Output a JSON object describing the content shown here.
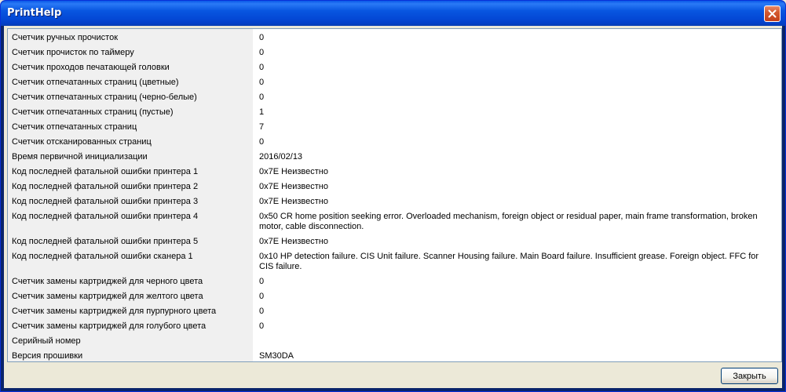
{
  "window": {
    "title": "PrintHelp",
    "close_icon": "close-icon"
  },
  "rows": [
    {
      "name": "Счетчик ручных прочисток",
      "value": "0"
    },
    {
      "name": "Счетчик прочисток по таймеру",
      "value": "0"
    },
    {
      "name": "Счетчик проходов печатающей головки",
      "value": "0"
    },
    {
      "name": "Счетчик отпечатанных страниц (цветные)",
      "value": "0"
    },
    {
      "name": "Счетчик отпечатанных страниц (черно-белые)",
      "value": "0"
    },
    {
      "name": "Счетчик отпечатанных страниц (пустые)",
      "value": "1"
    },
    {
      "name": "Счетчик отпечатанных страниц",
      "value": "7"
    },
    {
      "name": "Счетчик отсканированных страниц",
      "value": "0"
    },
    {
      "name": "Время первичной инициализации",
      "value": "2016/02/13"
    },
    {
      "name": "Код последней фатальной ошибки принтера 1",
      "value": "0x7E Неизвестно"
    },
    {
      "name": "Код последней фатальной ошибки принтера 2",
      "value": "0x7E Неизвестно"
    },
    {
      "name": "Код последней фатальной ошибки принтера 3",
      "value": "0x7E Неизвестно"
    },
    {
      "name": "Код последней фатальной ошибки принтера 4",
      "value": "0x50 CR home position seeking error. Overloaded mechanism, foreign object or residual paper, main frame transformation, broken motor, cable disconnection."
    },
    {
      "name": "Код последней фатальной ошибки принтера 5",
      "value": "0x7E Неизвестно"
    },
    {
      "name": "Код последней фатальной ошибки сканера 1",
      "value": "0x10 HP detection failure. CIS Unit failure. Scanner Housing failure. Main Board failure. Insufficient grease. Foreign object. FFC for CIS failure."
    },
    {
      "name": "Счетчик замены картриджей для черного цвета",
      "value": "0"
    },
    {
      "name": "Счетчик замены картриджей для желтого цвета",
      "value": "0"
    },
    {
      "name": "Счетчик замены картриджей для пурпурного цвета",
      "value": "0"
    },
    {
      "name": "Счетчик замены картриджей для голубого цвета",
      "value": "0"
    },
    {
      "name": "Серийный номер",
      "value": ""
    },
    {
      "name": "Версия прошивки",
      "value": "SM30DA"
    }
  ],
  "footer": {
    "close_button_label": "Закрыть"
  }
}
